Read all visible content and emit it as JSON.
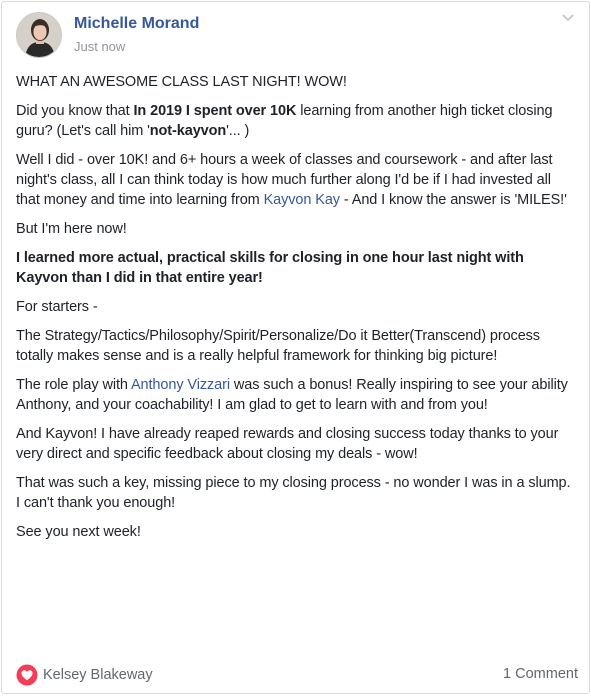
{
  "post": {
    "author": "Michelle Morand",
    "timestamp": "Just now",
    "options_icon": "chevron-down-icon",
    "paragraphs": {
      "p1": "WHAT AN AWESOME CLASS LAST NIGHT! WOW!",
      "p2_a": "Did you know that ",
      "p2_b": "In 2019 I spent over 10K",
      "p2_c": " learning from another high ticket closing guru? (Let's call him '",
      "p2_d": "not-kayvon",
      "p2_e": "'... )",
      "p3_a": "Well I did - over 10K! and 6+ hours a week of classes and coursework - and after last night's class, all I can think today is how much further along I'd be if I had invested all that money and time into learning from ",
      "p3_link": "Kayvon Kay",
      "p3_b": " -  And I know the answer is 'MILES!'",
      "p4": "But I'm here now!",
      "p5": "I learned more actual, practical skills for closing in one hour last night with Kayvon than I did in that entire year!",
      "p6": "For starters -",
      "p7": "The Strategy/Tactics/Philosophy/Spirit/Personalize/Do it Better(Transcend) process totally makes sense and is a really helpful framework for thinking big picture!",
      "p8_a": "The role play with ",
      "p8_link": "Anthony Vizzari",
      "p8_b": " was such a bonus! Really inspiring to see your ability Anthony, and your coachability!  I am glad to get to learn with and from you!",
      "p9": "And Kayvon! I have already reaped rewards and closing success today thanks to your very direct and specific feedback about closing my deals - wow!",
      "p10": "That was such a key, missing piece to my closing process - no wonder I was in a slump. I can't thank you enough!",
      "p11": "See you next week!"
    },
    "reactions": {
      "icon": "heart-reaction-icon",
      "color": "#f33e58",
      "name": "Kelsey Blakeway"
    },
    "comments_count": "1 Comment"
  }
}
